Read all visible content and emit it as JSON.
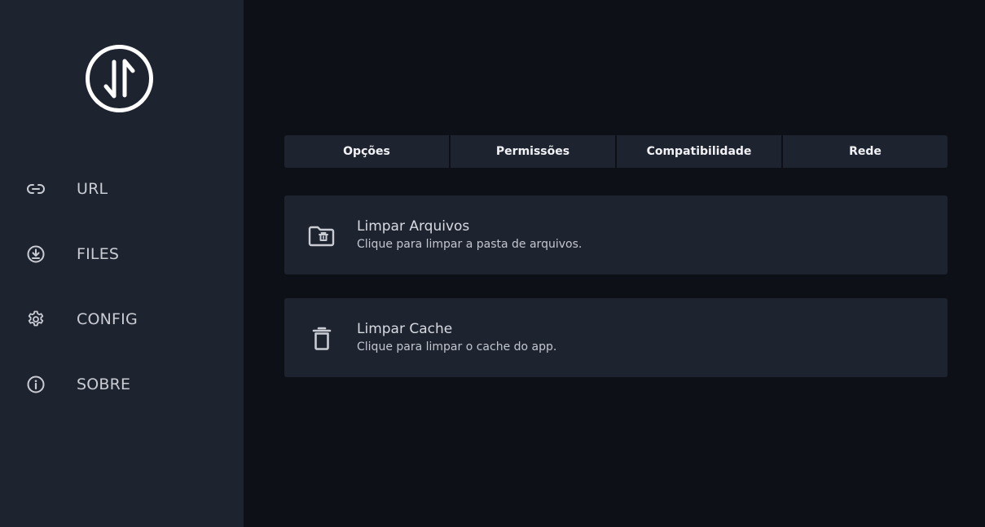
{
  "sidebar": {
    "logo_icon": "up-down-arrows-circle-icon",
    "items": [
      {
        "label": "URL",
        "icon": "link-icon"
      },
      {
        "label": "FILES",
        "icon": "download-circle-icon"
      },
      {
        "label": "CONFIG",
        "icon": "gear-icon"
      },
      {
        "label": "SOBRE",
        "icon": "info-icon"
      }
    ]
  },
  "tabs": [
    {
      "label": "Opções"
    },
    {
      "label": "Permissões"
    },
    {
      "label": "Compatibilidade"
    },
    {
      "label": "Rede"
    }
  ],
  "cards": [
    {
      "title": "Limpar Arquivos",
      "subtitle": "Clique para limpar a pasta de arquivos.",
      "icon": "folder-trash-icon"
    },
    {
      "title": "Limpar Cache",
      "subtitle": "Clique para limpar o cache do app.",
      "icon": "trash-icon"
    }
  ],
  "colors": {
    "background": "#0d1117",
    "surface": "#1e2330",
    "text": "#e6e8ec",
    "icon": "#c9ccd3"
  }
}
